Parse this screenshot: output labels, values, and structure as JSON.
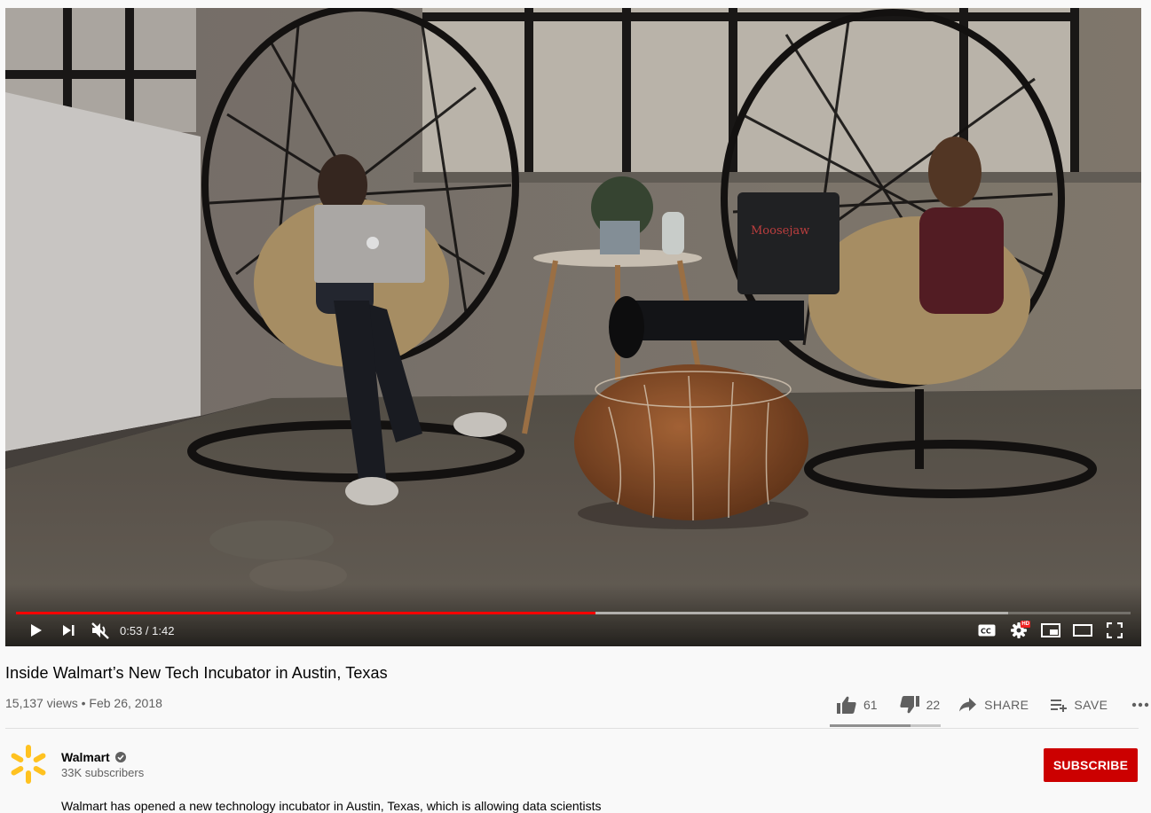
{
  "player": {
    "current_time": "0:53",
    "duration": "1:42",
    "time_separator": " / ",
    "played_fraction": 0.52,
    "buffered_fraction": 0.89,
    "muted": true,
    "hd_badge": "HD",
    "colors": {
      "progress": "#ff0000"
    },
    "icons": [
      "play-icon",
      "next-icon",
      "muted-volume-icon",
      "captions-icon",
      "settings-icon",
      "miniplayer-icon",
      "theater-icon",
      "fullscreen-icon"
    ]
  },
  "video": {
    "title": "Inside Walmart’s New Tech Incubator in Austin, Texas",
    "views": "15,137 views",
    "separator": " • ",
    "date": "Feb 26, 2018"
  },
  "actions": {
    "likes": "61",
    "dislikes": "22",
    "like_fraction": 0.73,
    "share_label": "SHARE",
    "save_label": "SAVE",
    "icons": [
      "thumbs-up-icon",
      "thumbs-down-icon",
      "share-arrow-icon",
      "playlist-add-icon",
      "more-icon"
    ]
  },
  "channel": {
    "name": "Walmart",
    "subscribers": "33K subscribers",
    "subscribe_label": "SUBSCRIBE",
    "colors": {
      "logo": "#ffc220",
      "subscribe": "#cc0000"
    }
  },
  "description": {
    "first_line": "Walmart has opened a new technology incubator in Austin, Texas, which is allowing data scientists"
  }
}
